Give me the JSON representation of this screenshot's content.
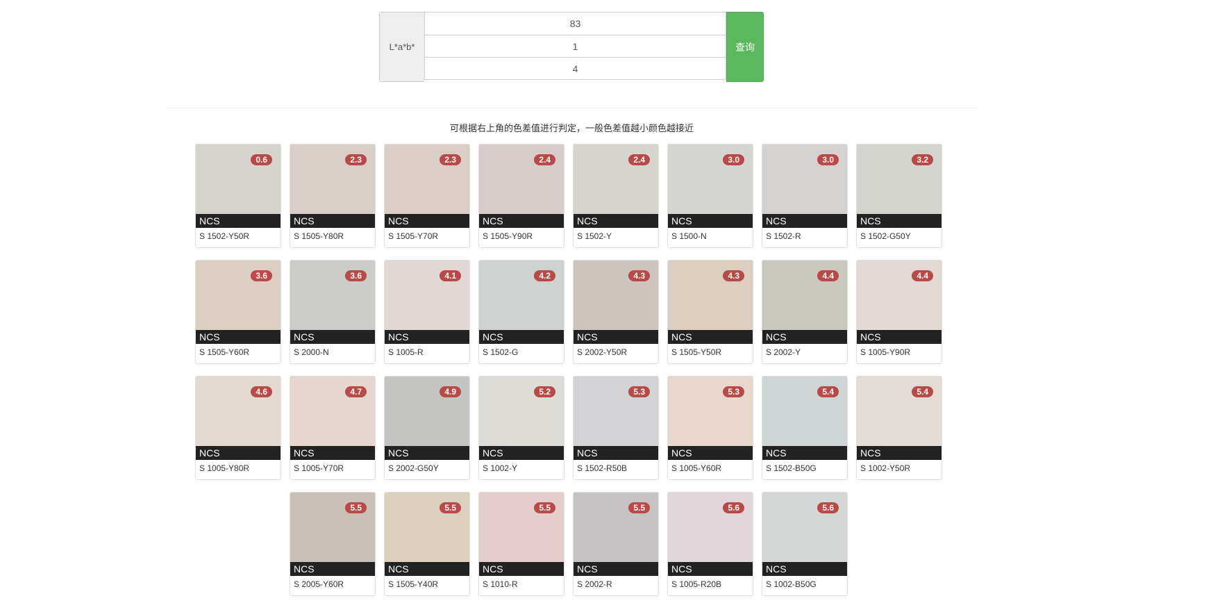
{
  "form": {
    "addon_label": "L*a*b*",
    "l_value": "83",
    "a_value": "1",
    "b_value": "4",
    "submit_label": "查询"
  },
  "hint": "可根据右上角的色差值进行判定，一般色差值越小颜色越接近",
  "colors": {
    "badge": "#b94a48",
    "button": "#5cb85c",
    "bar": "#222222"
  },
  "results": [
    {
      "diff": "0.6",
      "system": "NCS",
      "code": "S 1502-Y50R",
      "color": "#d6d2cc"
    },
    {
      "diff": "2.3",
      "system": "NCS",
      "code": "S 1505-Y80R",
      "color": "#d9cdc8"
    },
    {
      "diff": "2.3",
      "system": "NCS",
      "code": "S 1505-Y70R",
      "color": "#dacdc5"
    },
    {
      "diff": "2.4",
      "system": "NCS",
      "code": "S 1505-Y90R",
      "color": "#d8ccca"
    },
    {
      "diff": "2.4",
      "system": "NCS",
      "code": "S 1502-Y",
      "color": "#d5d4cd"
    },
    {
      "diff": "3.0",
      "system": "NCS",
      "code": "S 1500-N",
      "color": "#d5d5d2"
    },
    {
      "diff": "3.0",
      "system": "NCS",
      "code": "S 1502-R",
      "color": "#d6d1d1"
    },
    {
      "diff": "3.2",
      "system": "NCS",
      "code": "S 1502-G50Y",
      "color": "#d3d4ce"
    },
    {
      "diff": "3.6",
      "system": "NCS",
      "code": "S 1505-Y60R",
      "color": "#dacfc2"
    },
    {
      "diff": "3.6",
      "system": "NCS",
      "code": "S 2000-N",
      "color": "#cbcbc8"
    },
    {
      "diff": "4.1",
      "system": "NCS",
      "code": "S 1005-R",
      "color": "#e1d7d5"
    },
    {
      "diff": "4.2",
      "system": "NCS",
      "code": "S 1502-G",
      "color": "#cdd1d0"
    },
    {
      "diff": "4.3",
      "system": "NCS",
      "code": "S 2002-Y50R",
      "color": "#cdc4bd"
    },
    {
      "diff": "4.3",
      "system": "NCS",
      "code": "S 1505-Y50R",
      "color": "#dccdc1"
    },
    {
      "diff": "4.4",
      "system": "NCS",
      "code": "S 2002-Y",
      "color": "#cac7be"
    },
    {
      "diff": "4.4",
      "system": "NCS",
      "code": "S 1005-Y90R",
      "color": "#e3d8d3"
    },
    {
      "diff": "4.6",
      "system": "NCS",
      "code": "S 1005-Y80R",
      "color": "#e3d9d1"
    },
    {
      "diff": "4.7",
      "system": "NCS",
      "code": "S 1005-Y70R",
      "color": "#e6d6d0"
    },
    {
      "diff": "4.9",
      "system": "NCS",
      "code": "S 2002-G50Y",
      "color": "#c4c5c0"
    },
    {
      "diff": "5.2",
      "system": "NCS",
      "code": "S 1002-Y",
      "color": "#dedcd6"
    },
    {
      "diff": "5.3",
      "system": "NCS",
      "code": "S 1502-R50B",
      "color": "#d3d2d4"
    },
    {
      "diff": "5.3",
      "system": "NCS",
      "code": "S 1005-Y60R",
      "color": "#e7d7cd"
    },
    {
      "diff": "5.4",
      "system": "NCS",
      "code": "S 1502-B50G",
      "color": "#cfd5d4"
    },
    {
      "diff": "5.4",
      "system": "NCS",
      "code": "S 1002-Y50R",
      "color": "#e3dbd6"
    },
    {
      "diff": "5.5",
      "system": "NCS",
      "code": "S 2005-Y60R",
      "color": "#cbc0b8"
    },
    {
      "diff": "5.5",
      "system": "NCS",
      "code": "S 1505-Y40R",
      "color": "#dbd0bf"
    },
    {
      "diff": "5.5",
      "system": "NCS",
      "code": "S 1010-R",
      "color": "#e3cdcd"
    },
    {
      "diff": "5.5",
      "system": "NCS",
      "code": "S 2002-R",
      "color": "#c7c2c4"
    },
    {
      "diff": "5.6",
      "system": "NCS",
      "code": "S 1005-R20B",
      "color": "#e1d6da"
    },
    {
      "diff": "5.6",
      "system": "NCS",
      "code": "S 1002-B50G",
      "color": "#d3d8d7"
    }
  ]
}
